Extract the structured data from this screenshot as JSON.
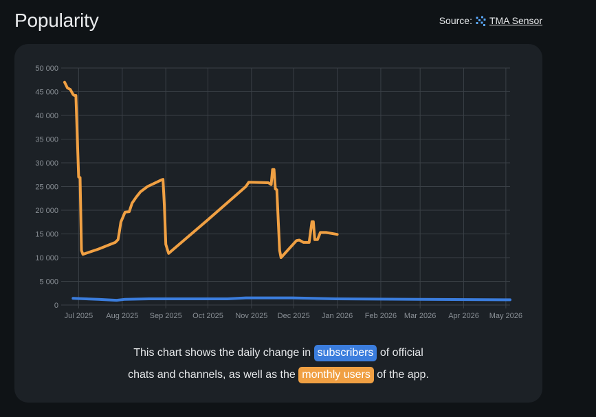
{
  "page": {
    "title": "Popularity",
    "source_label": "Source:",
    "source_link": "TMA Sensor"
  },
  "caption": {
    "line1_a": "This chart shows the daily change in",
    "subscribers": "subscribers",
    "line1_b": "of official",
    "line2_a": "chats and channels, as well as the",
    "monthly_users": "monthly users",
    "line2_b": "of the app."
  },
  "colors": {
    "subscribers": "#3b7ddd",
    "monthly_users": "#f0a043",
    "grid": "#3a4046",
    "tick": "#8a9096"
  },
  "chart_data": {
    "type": "line",
    "ylim": [
      0,
      50000
    ],
    "yticks": [
      "0",
      "5 000",
      "10 000",
      "15 000",
      "20 000",
      "25 000",
      "30 000",
      "35 000",
      "40 000",
      "45 000",
      "50 000"
    ],
    "xlim": [
      "2025-06-21",
      "2026-05-04"
    ],
    "xticks": [
      {
        "date": "2025-07-01",
        "label": "Jul 2025"
      },
      {
        "date": "2025-08-01",
        "label": "Aug 2025"
      },
      {
        "date": "2025-09-01",
        "label": "Sep 2025"
      },
      {
        "date": "2025-10-01",
        "label": "Oct 2025"
      },
      {
        "date": "2025-11-01",
        "label": "Nov 2025"
      },
      {
        "date": "2025-12-01",
        "label": "Dec 2025"
      },
      {
        "date": "2026-01-01",
        "label": "Jan 2026"
      },
      {
        "date": "2026-02-01",
        "label": "Feb 2026"
      },
      {
        "date": "2026-03-01",
        "label": "Mar 2026"
      },
      {
        "date": "2026-04-01",
        "label": "Apr 2026"
      },
      {
        "date": "2026-05-01",
        "label": "May 2026"
      }
    ],
    "grid": true,
    "legend": "none",
    "series": [
      {
        "key": "monthly_users",
        "points": [
          [
            "2025-06-21",
            47000
          ],
          [
            "2025-06-23",
            45800
          ],
          [
            "2025-06-25",
            45500
          ],
          [
            "2025-06-27",
            44400
          ],
          [
            "2025-06-28",
            44200
          ],
          [
            "2025-06-29",
            44200
          ],
          [
            "2025-07-01",
            27000
          ],
          [
            "2025-07-02",
            26900
          ],
          [
            "2025-07-03",
            11500
          ],
          [
            "2025-07-04",
            10700
          ],
          [
            "2025-07-15",
            11800
          ],
          [
            "2025-07-27",
            13200
          ],
          [
            "2025-07-29",
            13800
          ],
          [
            "2025-07-30",
            15500
          ],
          [
            "2025-07-31",
            17500
          ],
          [
            "2025-08-03",
            19600
          ],
          [
            "2025-08-06",
            19700
          ],
          [
            "2025-08-08",
            21500
          ],
          [
            "2025-08-11",
            22800
          ],
          [
            "2025-08-14",
            23900
          ],
          [
            "2025-08-19",
            25000
          ],
          [
            "2025-08-24",
            25700
          ],
          [
            "2025-08-29",
            26400
          ],
          [
            "2025-08-30",
            26500
          ],
          [
            "2025-08-31",
            21000
          ],
          [
            "2025-09-01",
            12800
          ],
          [
            "2025-09-03",
            10900
          ],
          [
            "2025-10-01",
            18000
          ],
          [
            "2025-10-28",
            25000
          ],
          [
            "2025-10-30",
            25900
          ],
          [
            "2025-11-13",
            25800
          ],
          [
            "2025-11-15",
            25400
          ],
          [
            "2025-11-16",
            28600
          ],
          [
            "2025-11-17",
            28600
          ],
          [
            "2025-11-18",
            24500
          ],
          [
            "2025-11-19",
            24300
          ],
          [
            "2025-11-21",
            11500
          ],
          [
            "2025-11-22",
            10000
          ],
          [
            "2025-12-03",
            13600
          ],
          [
            "2025-12-05",
            13700
          ],
          [
            "2025-12-08",
            13200
          ],
          [
            "2025-12-12",
            13200
          ],
          [
            "2025-12-14",
            17600
          ],
          [
            "2025-12-15",
            17600
          ],
          [
            "2025-12-16",
            13800
          ],
          [
            "2025-12-18",
            13800
          ],
          [
            "2025-12-20",
            15300
          ],
          [
            "2025-12-24",
            15300
          ],
          [
            "2026-01-01",
            14900
          ]
        ]
      },
      {
        "key": "subscribers",
        "points": [
          [
            "2025-06-27",
            1400
          ],
          [
            "2025-07-15",
            1200
          ],
          [
            "2025-07-28",
            1000
          ],
          [
            "2025-08-03",
            1200
          ],
          [
            "2025-08-20",
            1300
          ],
          [
            "2025-09-30",
            1300
          ],
          [
            "2025-10-15",
            1300
          ],
          [
            "2025-10-28",
            1500
          ],
          [
            "2025-11-30",
            1500
          ],
          [
            "2025-12-31",
            1300
          ],
          [
            "2026-02-28",
            1200
          ],
          [
            "2026-04-30",
            1100
          ],
          [
            "2026-05-04",
            1100
          ]
        ]
      }
    ]
  }
}
